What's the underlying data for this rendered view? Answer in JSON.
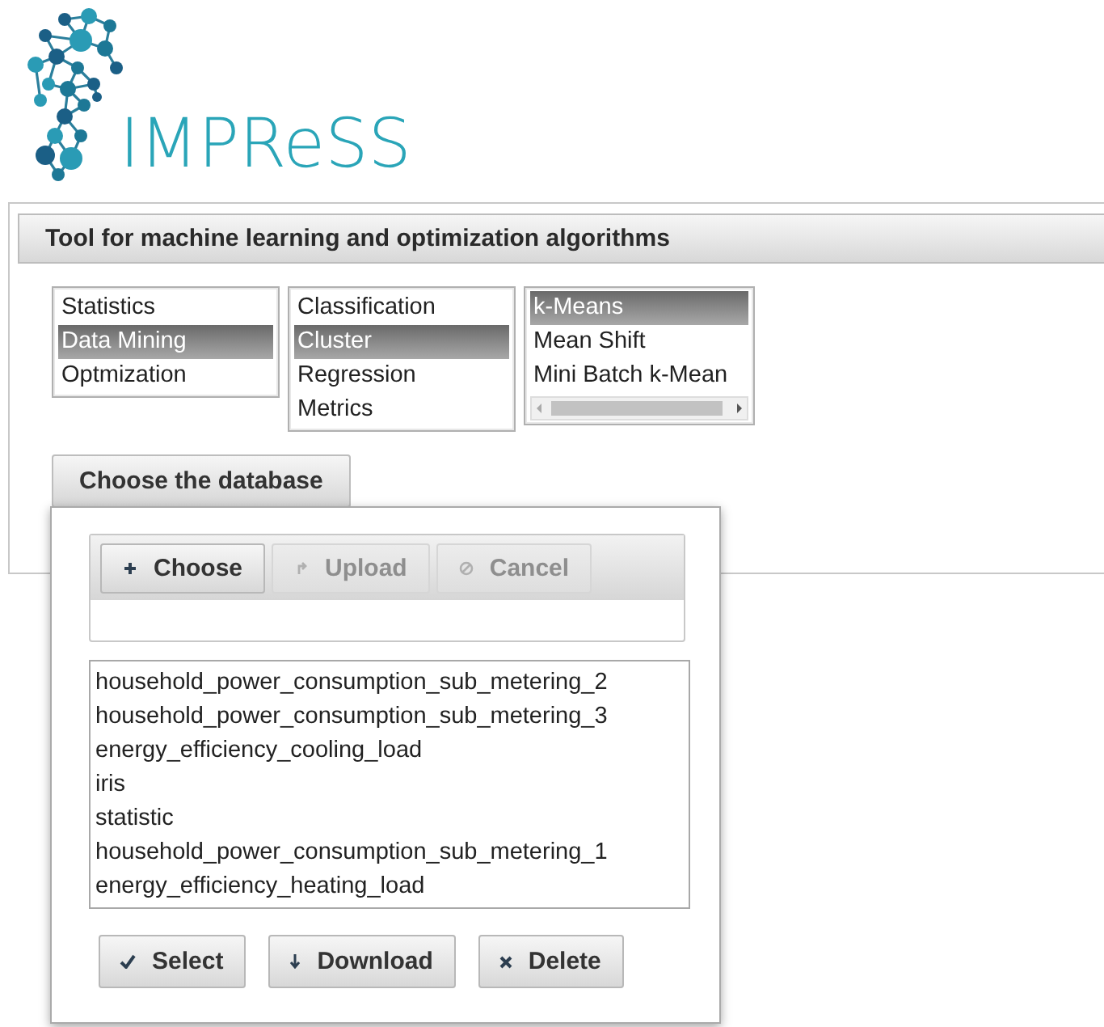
{
  "logo": {
    "text": "IMPReSS"
  },
  "panel": {
    "title": "Tool for machine learning and optimization algorithms"
  },
  "lists": [
    {
      "scrollbar": false,
      "items": [
        {
          "label": "Statistics",
          "selected": false
        },
        {
          "label": "Data Mining",
          "selected": true
        },
        {
          "label": "Optmization",
          "selected": false
        }
      ]
    },
    {
      "scrollbar": false,
      "items": [
        {
          "label": "Classification",
          "selected": false
        },
        {
          "label": "Cluster",
          "selected": true
        },
        {
          "label": "Regression",
          "selected": false
        },
        {
          "label": "Metrics",
          "selected": false
        }
      ]
    },
    {
      "scrollbar": true,
      "items": [
        {
          "label": "k-Means",
          "selected": true
        },
        {
          "label": "Mean Shift",
          "selected": false
        },
        {
          "label": "Mini Batch k-Mean",
          "selected": false
        }
      ]
    }
  ],
  "choose_button": "Choose the database",
  "dialog": {
    "toolbar": [
      {
        "label": "Choose",
        "kind": "add",
        "disabled": false
      },
      {
        "label": "Upload",
        "kind": "upload",
        "disabled": true
      },
      {
        "label": "Cancel",
        "kind": "cancel",
        "disabled": true
      }
    ],
    "files": [
      "household_power_consumption_sub_metering_2",
      "household_power_consumption_sub_metering_3",
      "energy_efficiency_cooling_load",
      "iris",
      "statistic",
      "household_power_consumption_sub_metering_1",
      "energy_efficiency_heating_load"
    ],
    "actions": [
      {
        "label": "Select",
        "kind": "check"
      },
      {
        "label": "Download",
        "kind": "download"
      },
      {
        "label": "Delete",
        "kind": "delete"
      }
    ]
  }
}
